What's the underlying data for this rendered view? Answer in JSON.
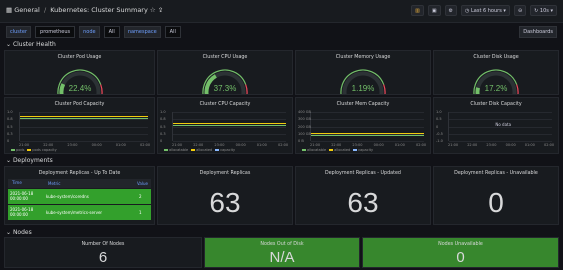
{
  "header": {
    "breadcrumb": [
      "General",
      "Kubernetes: Cluster Summary"
    ],
    "time_range": "Last 6 hours",
    "refresh": "10s"
  },
  "variables": [
    {
      "label": "cluster",
      "value": "prometheus"
    },
    {
      "label": "node",
      "value": "All"
    },
    {
      "label": "namespace",
      "value": "All"
    }
  ],
  "home_label": "Dashboards",
  "sections": {
    "cluster_health": "Cluster Health",
    "deployments": "Deployments",
    "nodes": "Nodes"
  },
  "gauges": [
    {
      "title": "Cluster Pod Usage",
      "value": "22.4%",
      "pct": 0.224,
      "color": "#73bf69"
    },
    {
      "title": "Cluster CPU Usage",
      "value": "37.3%",
      "pct": 0.373,
      "color": "#73bf69"
    },
    {
      "title": "Cluster Memory Usage",
      "value": "1.19%",
      "pct": 0.0119,
      "color": "#73bf69"
    },
    {
      "title": "Cluster Disk Usage",
      "value": "17.2%",
      "pct": 0.172,
      "color": "#73bf69"
    }
  ],
  "capacity": [
    {
      "title": "Cluster Pod Capacity",
      "y_ticks": [
        "1.0",
        "0.8",
        "0.5",
        "0.3",
        "0"
      ],
      "x_ticks": [
        "21:00",
        "22:00",
        "23:00",
        "00:00",
        "01:00",
        "02:00"
      ],
      "legend": [
        "pods",
        "pods capacity"
      ],
      "line_level": 0.8
    },
    {
      "title": "Cluster CPU Capacity",
      "y_ticks": [
        "1.0",
        "0.8",
        "0.5",
        "0.3",
        "0"
      ],
      "x_ticks": [
        "21:00",
        "22:00",
        "23:00",
        "00:00",
        "01:00",
        "02:00"
      ],
      "legend": [
        "allocatable",
        "allocated",
        "capacity"
      ],
      "line_level": 0.55
    },
    {
      "title": "Cluster Mem Capacity",
      "y_ticks": [
        "400 GB",
        "300 GB",
        "200 GB",
        "100 GB",
        "0 B"
      ],
      "x_ticks": [
        "21:00",
        "22:00",
        "23:00",
        "00:00",
        "01:00",
        "02:00"
      ],
      "legend": [
        "allocatable",
        "allocated",
        "capacity"
      ],
      "line_level": 0.2
    },
    {
      "title": "Cluster Disk Capacity",
      "y_ticks": [
        "1.0",
        "0.5",
        "0",
        "-0.5",
        "-1.0"
      ],
      "x_ticks": [
        "21:00",
        "22:00",
        "23:00",
        "00:00",
        "01:00",
        "02:00"
      ],
      "legend": [],
      "no_data": "No data",
      "line_level": 0.5
    }
  ],
  "deploy_table": {
    "title": "Deployment Replicas - Up To Date",
    "columns": [
      "Time",
      "Metric",
      "Value"
    ],
    "rows": [
      {
        "time": "2021-06-18 00:00:00",
        "metric": "kube-system/coredns",
        "value": "2"
      },
      {
        "time": "2021-06-18 00:00:00",
        "metric": "kube-system/metrics-server",
        "value": "1"
      }
    ]
  },
  "deploy_stats": [
    {
      "title": "Deployment Replicas",
      "value": "63"
    },
    {
      "title": "Deployment Replicas - Updated",
      "value": "63"
    },
    {
      "title": "Deployment Replicas - Unavailable",
      "value": "0"
    }
  ],
  "nodes": [
    {
      "title": "Number Of Nodes",
      "value": "6",
      "bg": "#181b1f"
    },
    {
      "title": "Nodes Out of Disk",
      "value": "N/A",
      "bg": "#37872d"
    },
    {
      "title": "Nodes Unavailable",
      "value": "0",
      "bg": "#37872d"
    }
  ]
}
